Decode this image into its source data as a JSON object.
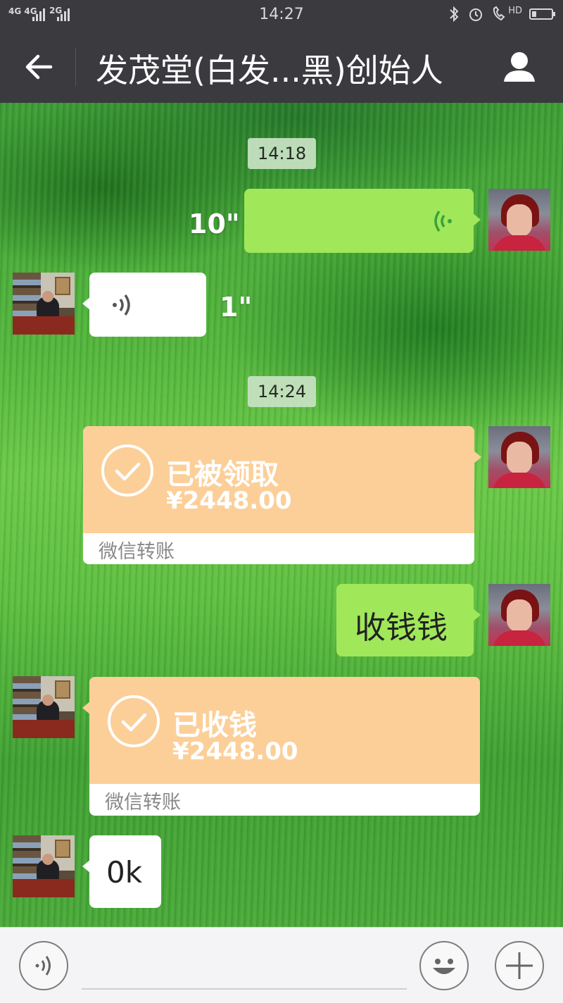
{
  "status_bar": {
    "network_left": "4G 4G",
    "network_right": "2G",
    "time": "14:27",
    "hd_label": "HD",
    "icons": [
      "signal-icon",
      "bluetooth-icon",
      "alarm-icon",
      "hd-call-icon",
      "battery-icon"
    ]
  },
  "header": {
    "title": "发茂堂(白发...黑)创始人",
    "back_icon": "arrow-left-icon",
    "profile_icon": "person-icon"
  },
  "messages": {
    "ts1": "14:18",
    "voice_out_duration": "10\"",
    "voice_in_duration": "1\"",
    "ts2": "14:24",
    "transfer_out": {
      "status": "已被领取",
      "amount": "¥2448.00",
      "label": "微信转账"
    },
    "text_out": "收钱钱",
    "transfer_in": {
      "status": "已收钱",
      "amount": "¥2448.00",
      "label": "微信转账"
    },
    "text_in": "0k"
  },
  "input_bar": {
    "icons": [
      "voice-input-icon",
      "emoji-icon",
      "plus-icon"
    ],
    "value": ""
  },
  "colors": {
    "bar": "#3a3a3f",
    "bubble_green": "#a0e75a",
    "transfer_orange": "#fccf99",
    "voice_green": "#3aa23a"
  }
}
